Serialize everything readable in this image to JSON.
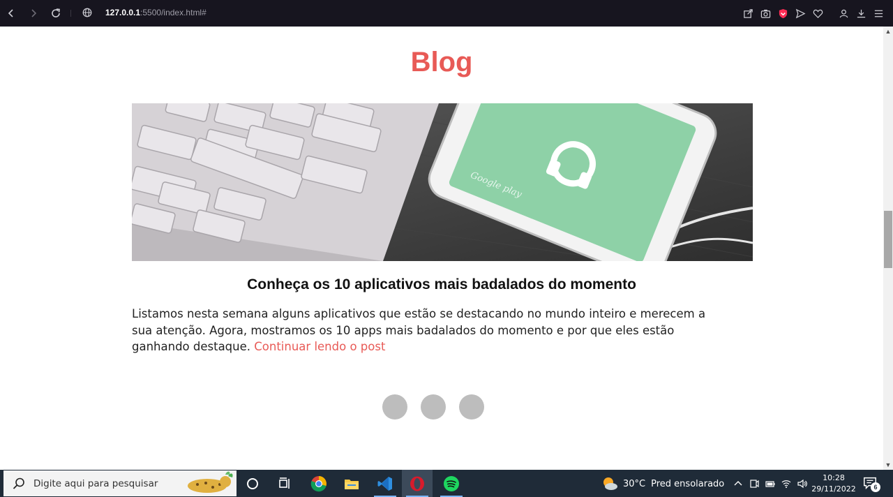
{
  "browser": {
    "url_host": "127.0.0.1",
    "url_rest": ":5500/index.html#",
    "icons": [
      "back-icon",
      "forward-icon",
      "reload-icon",
      "site-info-icon",
      "share-icon",
      "camera-icon",
      "shield-icon",
      "send-icon",
      "heart-icon",
      "account-icon",
      "download-icon",
      "menu-icon"
    ]
  },
  "page": {
    "heading": "Blog",
    "post": {
      "title": "Conheça os 10 aplicativos mais badalados do momento",
      "excerpt": "Listamos nesta semana alguns aplicativos que estão se destacando no mundo inteiro e merecem a sua atenção. Agora, mostramos os 10 apps mais badalados do momento e por que eles estão ganhando destaque.",
      "link_label": "Continuar lendo o post",
      "image_caption_text": "Google play"
    },
    "carousel_dots": 3
  },
  "taskbar": {
    "search_placeholder": "Digite aqui para pesquisar",
    "apps": [
      "cortana-icon",
      "task-view-icon",
      "chrome-icon",
      "file-explorer-icon",
      "vscode-icon",
      "opera-icon",
      "spotify-icon"
    ],
    "weather_temp": "30°C",
    "weather_text": "Pred ensolarado",
    "time": "10:28",
    "date": "29/11/2022",
    "notifications": "6"
  },
  "colors": {
    "accent": "#e85a56",
    "taskbar": "#1f2b38",
    "browser_bar": "#17151f"
  }
}
